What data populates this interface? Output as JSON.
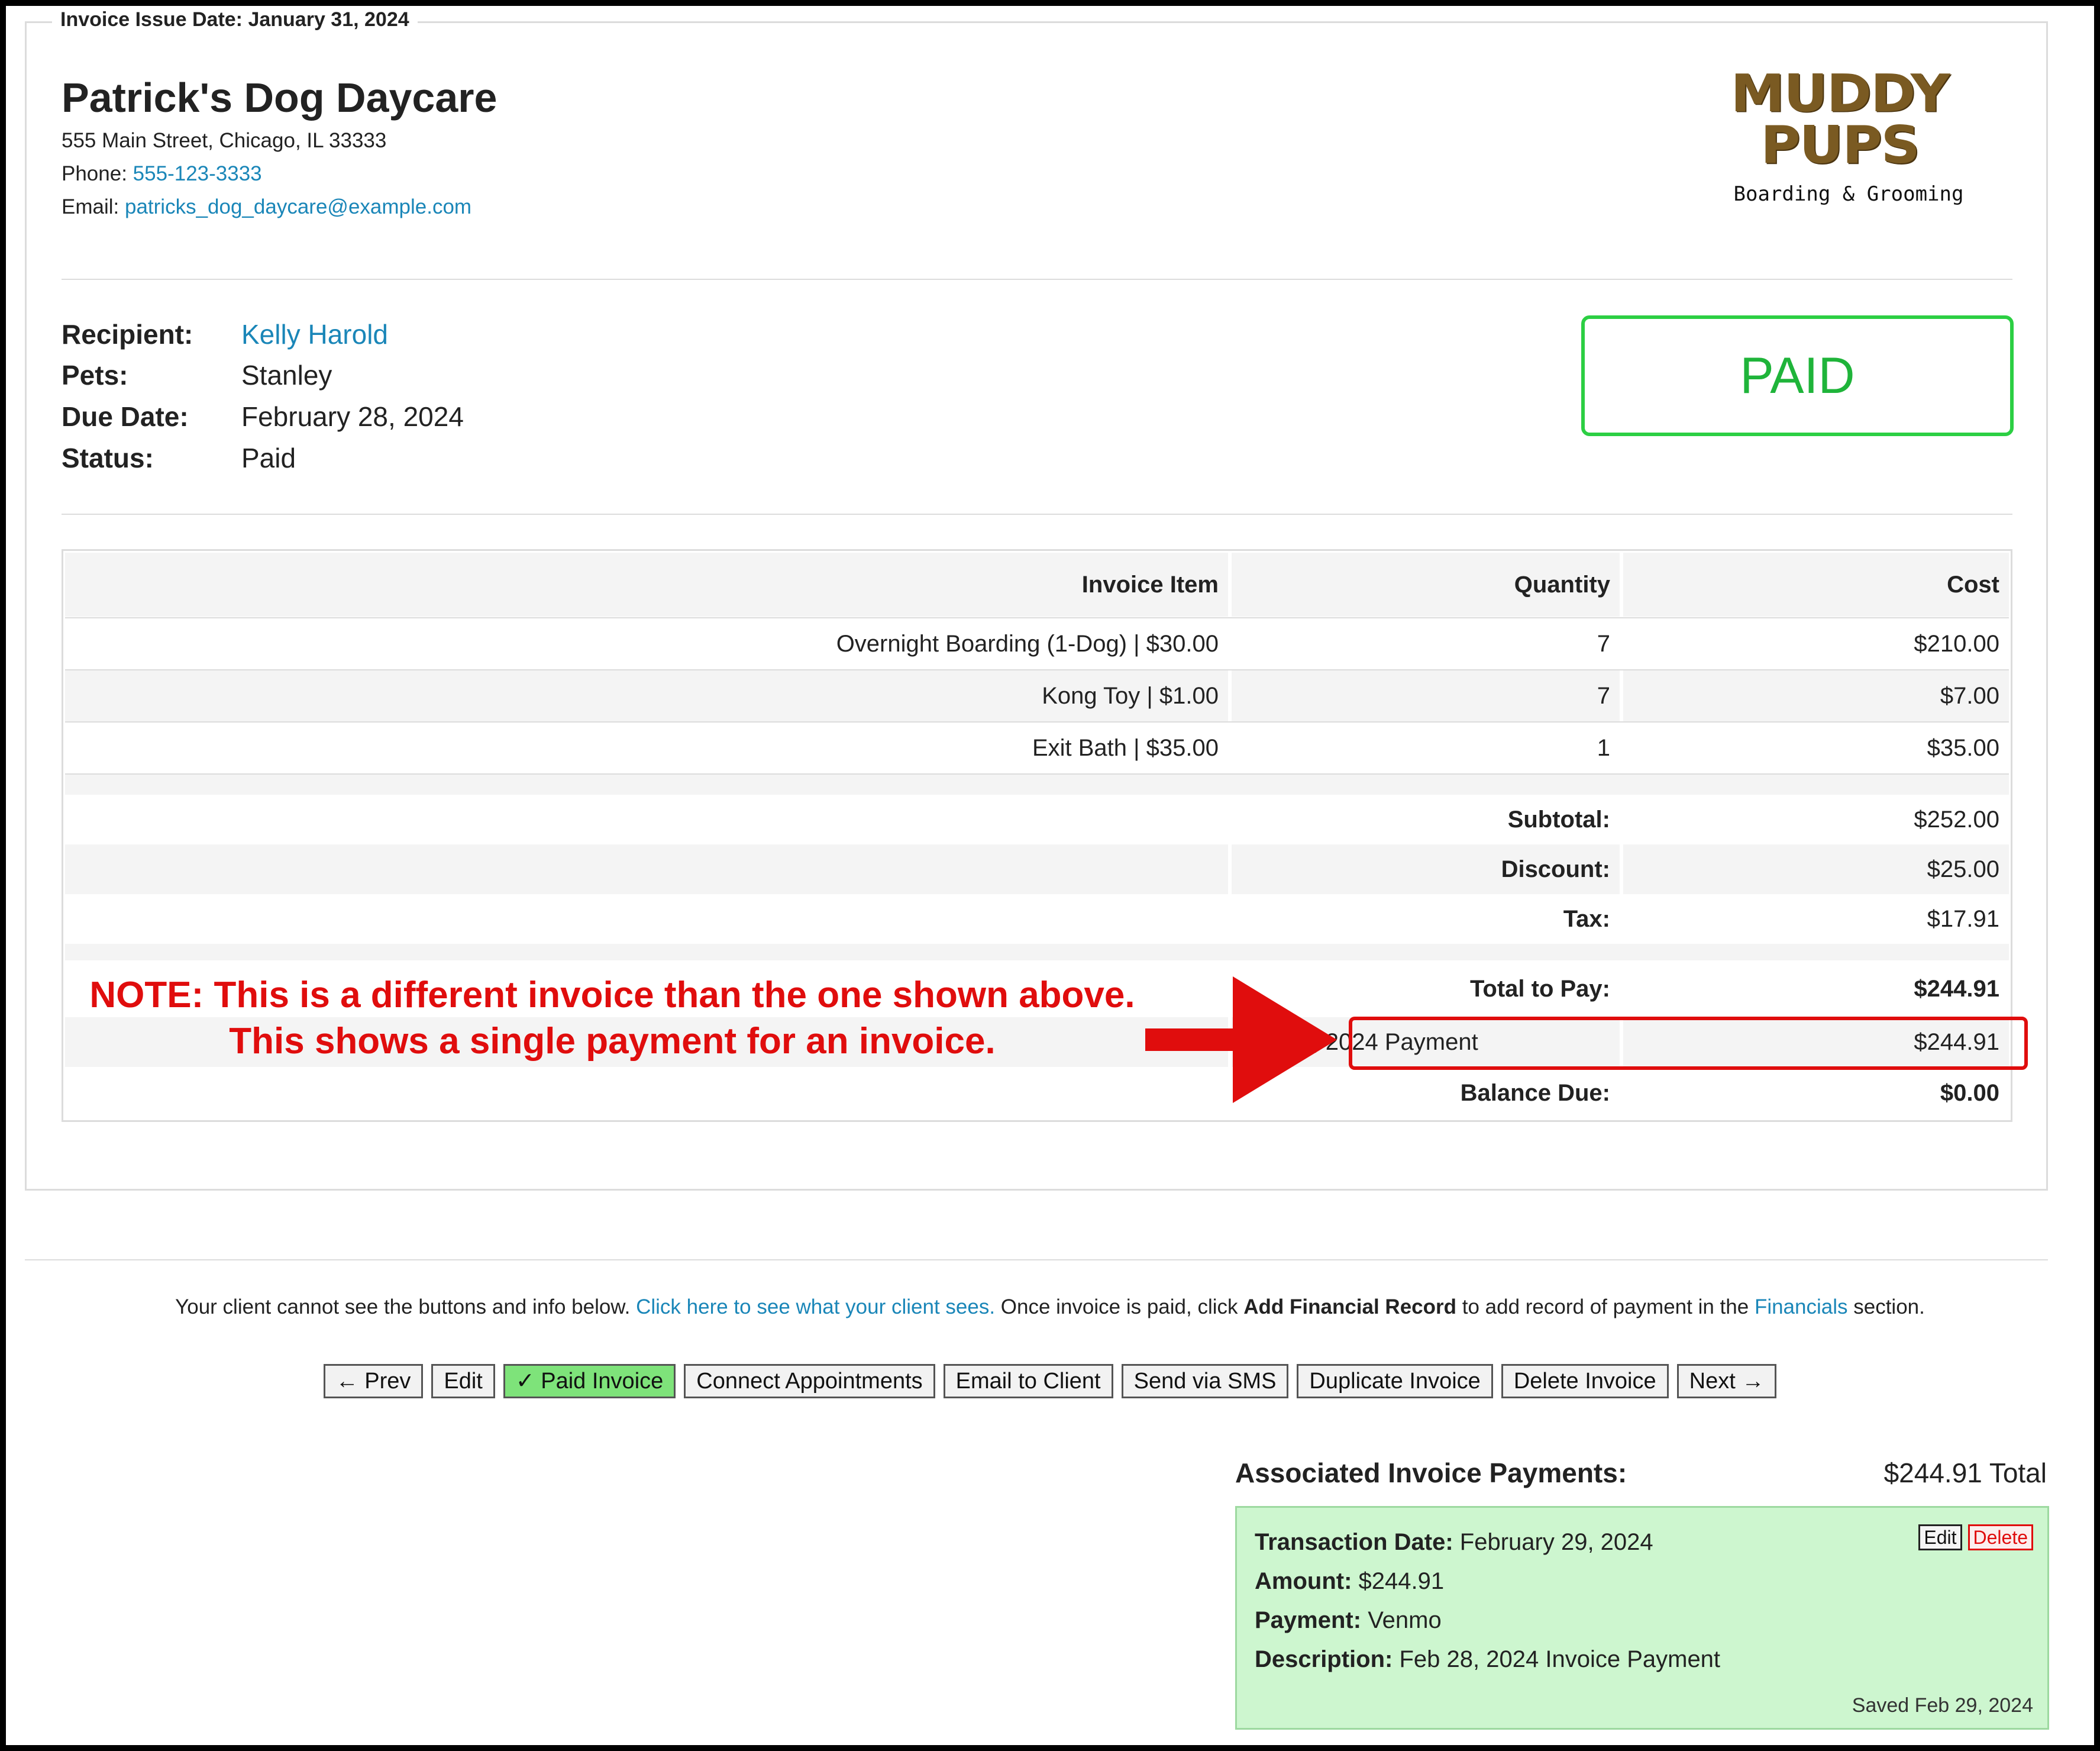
{
  "issue_legend": "Invoice Issue Date: January 31, 2024",
  "business": {
    "name": "Patrick's Dog Daycare",
    "address": "555 Main Street, Chicago, IL 33333",
    "phone_label": "Phone:",
    "phone": "555-123-3333",
    "email_label": "Email:",
    "email": "patricks_dog_daycare@example.com"
  },
  "logo": {
    "word": "MUDDY PUPS",
    "sub": "Boarding & Grooming",
    "color": "#7a5a22"
  },
  "details": {
    "recipient_label": "Recipient:",
    "recipient": "Kelly Harold",
    "pets_label": "Pets:",
    "pets": "Stanley",
    "due_label": "Due Date:",
    "due": "February 28, 2024",
    "status_label": "Status:",
    "status": "Paid"
  },
  "stamp": {
    "text": "PAID",
    "color": "#1fb43a"
  },
  "table": {
    "headers": [
      "Invoice Item",
      "Quantity",
      "Cost"
    ],
    "rows": [
      [
        "Overnight Boarding (1-Dog) | $30.00",
        "7",
        "$210.00"
      ],
      [
        "Kong Toy | $1.00",
        "7",
        "$7.00"
      ],
      [
        "Exit Bath | $35.00",
        "1",
        "$35.00"
      ]
    ],
    "subtotal_label": "Subtotal:",
    "subtotal": "$252.00",
    "discount_label": "Discount:",
    "discount": "$25.00",
    "tax_label": "Tax:",
    "tax": "$17.91",
    "total_label": "Total to Pay:",
    "total": "$244.91",
    "payment_label": "Feb 29, 2024 Payment",
    "payment": "$244.91",
    "balance_label": "Balance Due:",
    "balance": "$0.00"
  },
  "note": {
    "line1": "NOTE: This is a different invoice than the one shown above.",
    "line2": "This shows a single payment for an invoice.",
    "color": "#e00d0d"
  },
  "info": {
    "part1": "Your client cannot see the buttons and info below. ",
    "link1": "Click here to see what your client sees.",
    "part2": " Once invoice is paid, click ",
    "bold": "Add Financial Record",
    "part3": " to add record of payment in the ",
    "link2": "Financials",
    "part4": " section."
  },
  "buttons": {
    "prev": "← Prev",
    "edit": "Edit",
    "paid": "✓ Paid Invoice",
    "connect": "Connect Appointments",
    "email": "Email to Client",
    "sms": "Send via SMS",
    "duplicate": "Duplicate Invoice",
    "delete": "Delete Invoice",
    "next": "Next →"
  },
  "associated": {
    "title": "Associated Invoice Payments:",
    "total": "$244.91 Total",
    "card": {
      "date_label": "Transaction Date:",
      "date": "February 29, 2024",
      "amount_label": "Amount:",
      "amount": "$244.91",
      "payment_label": "Payment:",
      "payment": "Venmo",
      "desc_label": "Description:",
      "desc": "Feb 28, 2024 Invoice Payment",
      "edit": "Edit",
      "delete": "Delete",
      "saved": "Saved Feb 29, 2024"
    }
  }
}
